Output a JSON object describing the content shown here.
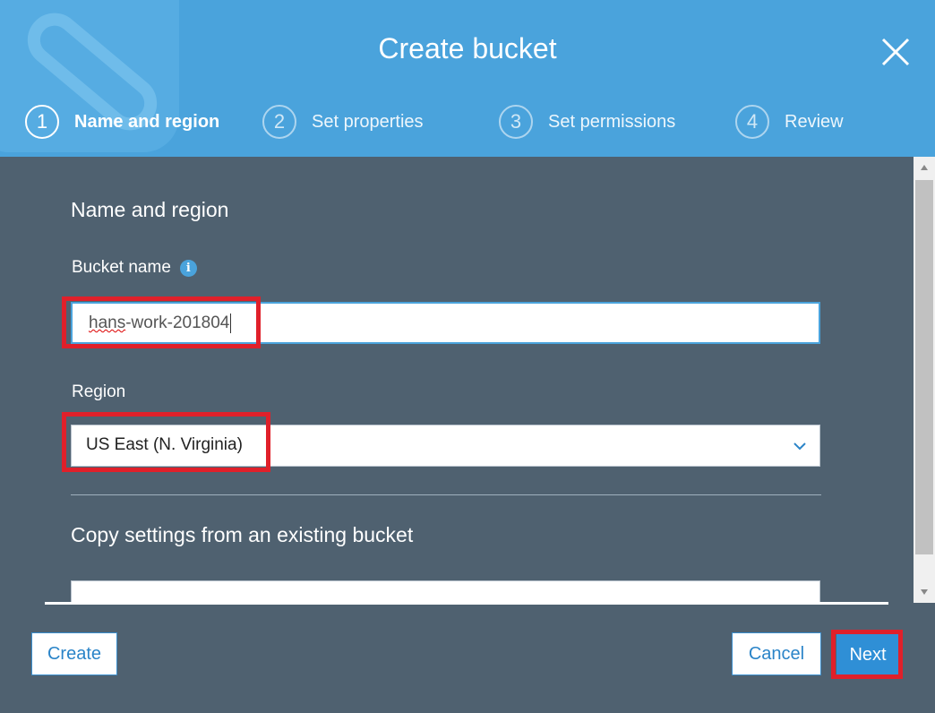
{
  "dialog": {
    "title": "Create bucket",
    "close_icon": "close-icon"
  },
  "steps": [
    {
      "number": "1",
      "label": "Name and region",
      "active": true
    },
    {
      "number": "2",
      "label": "Set properties",
      "active": false
    },
    {
      "number": "3",
      "label": "Set permissions",
      "active": false
    },
    {
      "number": "4",
      "label": "Review",
      "active": false
    }
  ],
  "form": {
    "section_title": "Name and region",
    "bucket_name_label": "Bucket name",
    "bucket_name_value_prefix": "hans",
    "bucket_name_value_rest": "-work-201804",
    "info_icon": "info-icon",
    "region_label": "Region",
    "region_value": "US East (N. Virginia)",
    "copy_settings_title": "Copy settings from an existing bucket"
  },
  "footer": {
    "create_label": "Create",
    "cancel_label": "Cancel",
    "next_label": "Next"
  },
  "colors": {
    "header": "#4aa3dc",
    "body": "#4f6170",
    "highlight": "#e0202a",
    "primary_button": "#2f8fd6"
  }
}
